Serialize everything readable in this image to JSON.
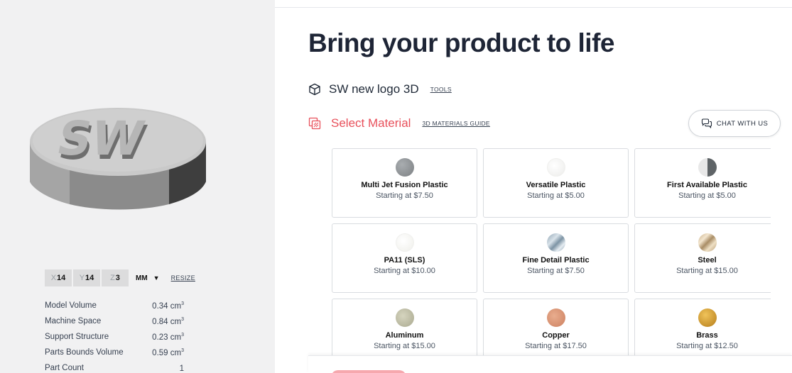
{
  "viewer": {
    "model_logo_text": "SW",
    "dimensions": [
      {
        "axis": "X",
        "value": "14"
      },
      {
        "axis": "Y",
        "value": "14"
      },
      {
        "axis": "Z",
        "value": "3"
      }
    ],
    "unit": "MM",
    "resize_label": "RESIZE",
    "stats": [
      {
        "label": "Model Volume",
        "value": "0.34 cm",
        "sup": "3"
      },
      {
        "label": "Machine Space",
        "value": "0.84 cm",
        "sup": "3"
      },
      {
        "label": "Support Structure",
        "value": "0.23 cm",
        "sup": "3"
      },
      {
        "label": "Parts Bounds Volume",
        "value": "0.59 cm",
        "sup": "3"
      },
      {
        "label": "Part Count",
        "value": "1",
        "sup": ""
      }
    ]
  },
  "main": {
    "title": "Bring your product to life",
    "model_name": "SW new logo 3D",
    "tools_label": "TOOLS",
    "select_material_label": "Select Material",
    "materials_guide_label": "3D MATERIALS GUIDE",
    "chat_label": "CHAT WITH US"
  },
  "materials": [
    {
      "name": "Multi Jet Fusion Plastic",
      "price": "Starting at $7.50"
    },
    {
      "name": "Versatile Plastic",
      "price": "Starting at $5.00"
    },
    {
      "name": "First Available Plastic",
      "price": "Starting at $5.00"
    },
    {
      "name": "PA11 (SLS)",
      "price": "Starting at $10.00"
    },
    {
      "name": "Fine Detail Plastic",
      "price": "Starting at $7.50"
    },
    {
      "name": "Steel",
      "price": "Starting at $15.00"
    },
    {
      "name": "Aluminum",
      "price": "Starting at $15.00"
    },
    {
      "name": "Copper",
      "price": "Starting at $17.50"
    },
    {
      "name": "Brass",
      "price": "Starting at $12.50"
    }
  ],
  "colors": {
    "accent_red": "#e8505b",
    "title_navy": "#1e2536",
    "viewer_bg": "#f1f1f2"
  }
}
